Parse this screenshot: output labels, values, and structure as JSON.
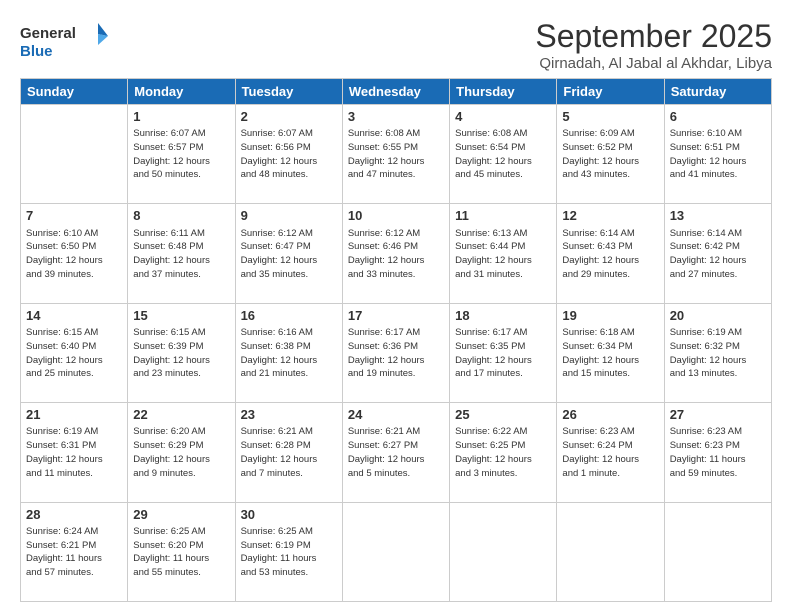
{
  "logo": {
    "line1": "General",
    "line2": "Blue"
  },
  "title": "September 2025",
  "subtitle": "Qirnadah, Al Jabal al Akhdar, Libya",
  "days_of_week": [
    "Sunday",
    "Monday",
    "Tuesday",
    "Wednesday",
    "Thursday",
    "Friday",
    "Saturday"
  ],
  "weeks": [
    [
      {
        "day": "",
        "info": ""
      },
      {
        "day": "1",
        "info": "Sunrise: 6:07 AM\nSunset: 6:57 PM\nDaylight: 12 hours\nand 50 minutes."
      },
      {
        "day": "2",
        "info": "Sunrise: 6:07 AM\nSunset: 6:56 PM\nDaylight: 12 hours\nand 48 minutes."
      },
      {
        "day": "3",
        "info": "Sunrise: 6:08 AM\nSunset: 6:55 PM\nDaylight: 12 hours\nand 47 minutes."
      },
      {
        "day": "4",
        "info": "Sunrise: 6:08 AM\nSunset: 6:54 PM\nDaylight: 12 hours\nand 45 minutes."
      },
      {
        "day": "5",
        "info": "Sunrise: 6:09 AM\nSunset: 6:52 PM\nDaylight: 12 hours\nand 43 minutes."
      },
      {
        "day": "6",
        "info": "Sunrise: 6:10 AM\nSunset: 6:51 PM\nDaylight: 12 hours\nand 41 minutes."
      }
    ],
    [
      {
        "day": "7",
        "info": "Sunrise: 6:10 AM\nSunset: 6:50 PM\nDaylight: 12 hours\nand 39 minutes."
      },
      {
        "day": "8",
        "info": "Sunrise: 6:11 AM\nSunset: 6:48 PM\nDaylight: 12 hours\nand 37 minutes."
      },
      {
        "day": "9",
        "info": "Sunrise: 6:12 AM\nSunset: 6:47 PM\nDaylight: 12 hours\nand 35 minutes."
      },
      {
        "day": "10",
        "info": "Sunrise: 6:12 AM\nSunset: 6:46 PM\nDaylight: 12 hours\nand 33 minutes."
      },
      {
        "day": "11",
        "info": "Sunrise: 6:13 AM\nSunset: 6:44 PM\nDaylight: 12 hours\nand 31 minutes."
      },
      {
        "day": "12",
        "info": "Sunrise: 6:14 AM\nSunset: 6:43 PM\nDaylight: 12 hours\nand 29 minutes."
      },
      {
        "day": "13",
        "info": "Sunrise: 6:14 AM\nSunset: 6:42 PM\nDaylight: 12 hours\nand 27 minutes."
      }
    ],
    [
      {
        "day": "14",
        "info": "Sunrise: 6:15 AM\nSunset: 6:40 PM\nDaylight: 12 hours\nand 25 minutes."
      },
      {
        "day": "15",
        "info": "Sunrise: 6:15 AM\nSunset: 6:39 PM\nDaylight: 12 hours\nand 23 minutes."
      },
      {
        "day": "16",
        "info": "Sunrise: 6:16 AM\nSunset: 6:38 PM\nDaylight: 12 hours\nand 21 minutes."
      },
      {
        "day": "17",
        "info": "Sunrise: 6:17 AM\nSunset: 6:36 PM\nDaylight: 12 hours\nand 19 minutes."
      },
      {
        "day": "18",
        "info": "Sunrise: 6:17 AM\nSunset: 6:35 PM\nDaylight: 12 hours\nand 17 minutes."
      },
      {
        "day": "19",
        "info": "Sunrise: 6:18 AM\nSunset: 6:34 PM\nDaylight: 12 hours\nand 15 minutes."
      },
      {
        "day": "20",
        "info": "Sunrise: 6:19 AM\nSunset: 6:32 PM\nDaylight: 12 hours\nand 13 minutes."
      }
    ],
    [
      {
        "day": "21",
        "info": "Sunrise: 6:19 AM\nSunset: 6:31 PM\nDaylight: 12 hours\nand 11 minutes."
      },
      {
        "day": "22",
        "info": "Sunrise: 6:20 AM\nSunset: 6:29 PM\nDaylight: 12 hours\nand 9 minutes."
      },
      {
        "day": "23",
        "info": "Sunrise: 6:21 AM\nSunset: 6:28 PM\nDaylight: 12 hours\nand 7 minutes."
      },
      {
        "day": "24",
        "info": "Sunrise: 6:21 AM\nSunset: 6:27 PM\nDaylight: 12 hours\nand 5 minutes."
      },
      {
        "day": "25",
        "info": "Sunrise: 6:22 AM\nSunset: 6:25 PM\nDaylight: 12 hours\nand 3 minutes."
      },
      {
        "day": "26",
        "info": "Sunrise: 6:23 AM\nSunset: 6:24 PM\nDaylight: 12 hours\nand 1 minute."
      },
      {
        "day": "27",
        "info": "Sunrise: 6:23 AM\nSunset: 6:23 PM\nDaylight: 11 hours\nand 59 minutes."
      }
    ],
    [
      {
        "day": "28",
        "info": "Sunrise: 6:24 AM\nSunset: 6:21 PM\nDaylight: 11 hours\nand 57 minutes."
      },
      {
        "day": "29",
        "info": "Sunrise: 6:25 AM\nSunset: 6:20 PM\nDaylight: 11 hours\nand 55 minutes."
      },
      {
        "day": "30",
        "info": "Sunrise: 6:25 AM\nSunset: 6:19 PM\nDaylight: 11 hours\nand 53 minutes."
      },
      {
        "day": "",
        "info": ""
      },
      {
        "day": "",
        "info": ""
      },
      {
        "day": "",
        "info": ""
      },
      {
        "day": "",
        "info": ""
      }
    ]
  ]
}
